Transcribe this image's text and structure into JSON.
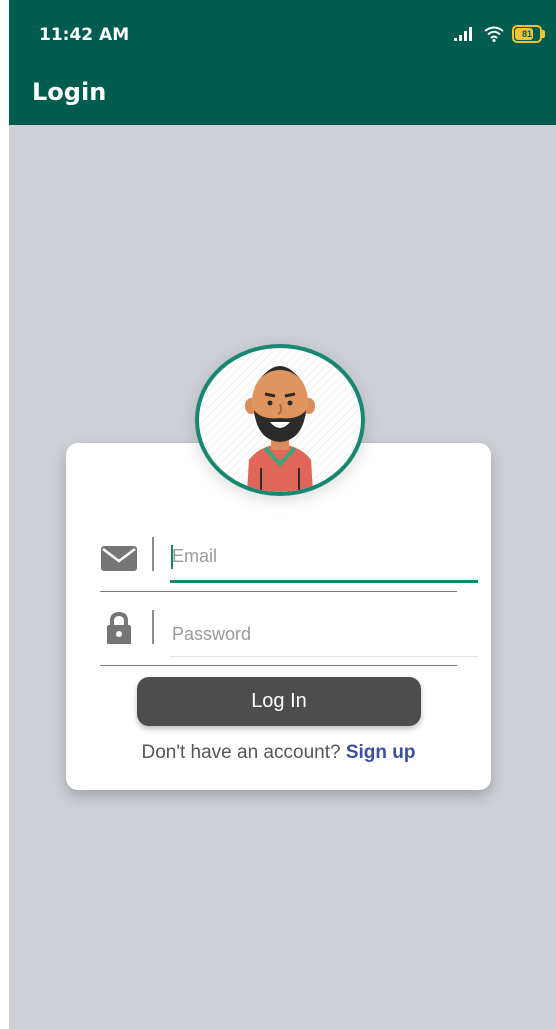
{
  "status_bar": {
    "time": "11:42 AM",
    "signal_icon": "cellular-signal-icon",
    "wifi_icon": "wifi-icon",
    "battery_icon": "battery-icon",
    "battery_level": "81",
    "battery_fraction": 0.81
  },
  "app_bar": {
    "title": "Login"
  },
  "avatar": {
    "icon": "user-avatar-icon"
  },
  "form": {
    "email": {
      "icon": "envelope-icon",
      "placeholder": "Email",
      "value": ""
    },
    "password": {
      "icon": "lock-icon",
      "placeholder": "Password",
      "value": ""
    },
    "login_label": "Log In",
    "signup_prompt": "Don't have an account? ",
    "signup_link": "Sign up"
  },
  "colors": {
    "primary": "#005c4f",
    "accent": "#17876f",
    "background": "#cdd0d5",
    "button": "#4d4d4d",
    "link": "#3b4ea4",
    "battery": "#f4c430"
  }
}
